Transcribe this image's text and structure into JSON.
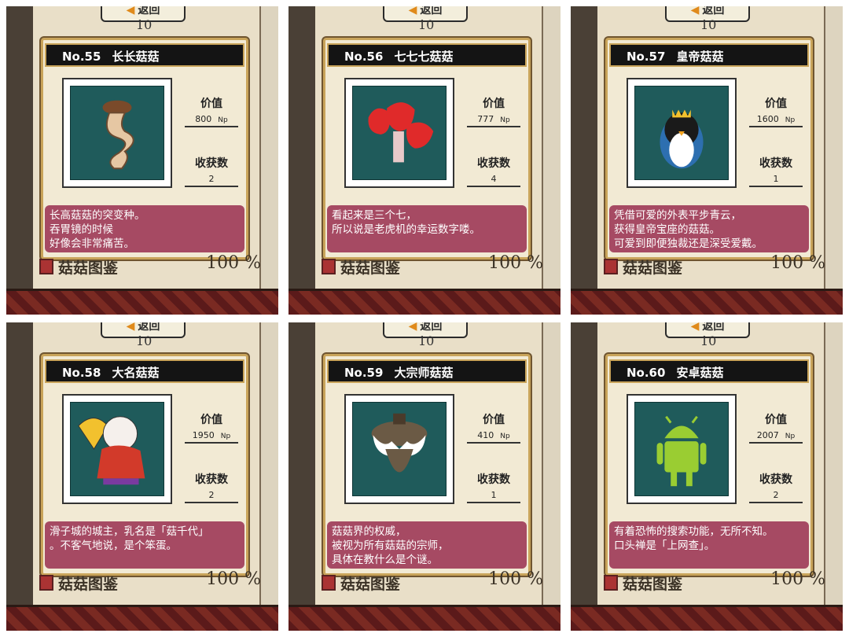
{
  "back_label": "返回",
  "page_number": "10",
  "footer": {
    "label": "菇菇图鉴",
    "percent": "100 %"
  },
  "stat_labels": {
    "price": "价值",
    "count": "收获数",
    "unit": "Np"
  },
  "cards": [
    {
      "no": "No.55",
      "name": "长长菇菇",
      "price": "800",
      "count": "2",
      "desc": "长高菇菇的突变种。\n吞胃镜的时候\n好像会非常痛苦。",
      "icon": "long-mushroom-icon",
      "color": "#e6c7a3"
    },
    {
      "no": "No.56",
      "name": "七七七菇菇",
      "price": "777",
      "count": "4",
      "desc": "看起来是三个七，\n所以说是老虎机的幸运数字喽。",
      "icon": "triple-seven-mushroom-icon",
      "color": "#e02a2a"
    },
    {
      "no": "No.57",
      "name": "皇帝菇菇",
      "price": "1600",
      "count": "1",
      "desc": "凭借可爱的外表平步青云，\n获得皇帝宝座的菇菇。\n可爱到即便独裁还是深受爱戴。",
      "icon": "emperor-penguin-mushroom-icon",
      "color": "#1a1a1a"
    },
    {
      "no": "No.58",
      "name": "大名菇菇",
      "price": "1950",
      "count": "2",
      "desc": "滑子城的城主，乳名是「菇千代」\n。不客气地说，是个笨蛋。",
      "icon": "daimyo-mushroom-icon",
      "color": "#f5f0ec"
    },
    {
      "no": "No.59",
      "name": "大宗师菇菇",
      "price": "410",
      "count": "1",
      "desc": "菇菇界的权威，\n被视为所有菇菇的宗师，\n具体在教什么是个谜。",
      "icon": "grandmaster-mushroom-icon",
      "color": "#6b5a45"
    },
    {
      "no": "No.60",
      "name": "安卓菇菇",
      "price": "2007",
      "count": "2",
      "desc": "有着恐怖的搜索功能，无所不知。\n口头禅是「上网查」。",
      "icon": "android-mushroom-icon",
      "color": "#9acd32"
    }
  ]
}
